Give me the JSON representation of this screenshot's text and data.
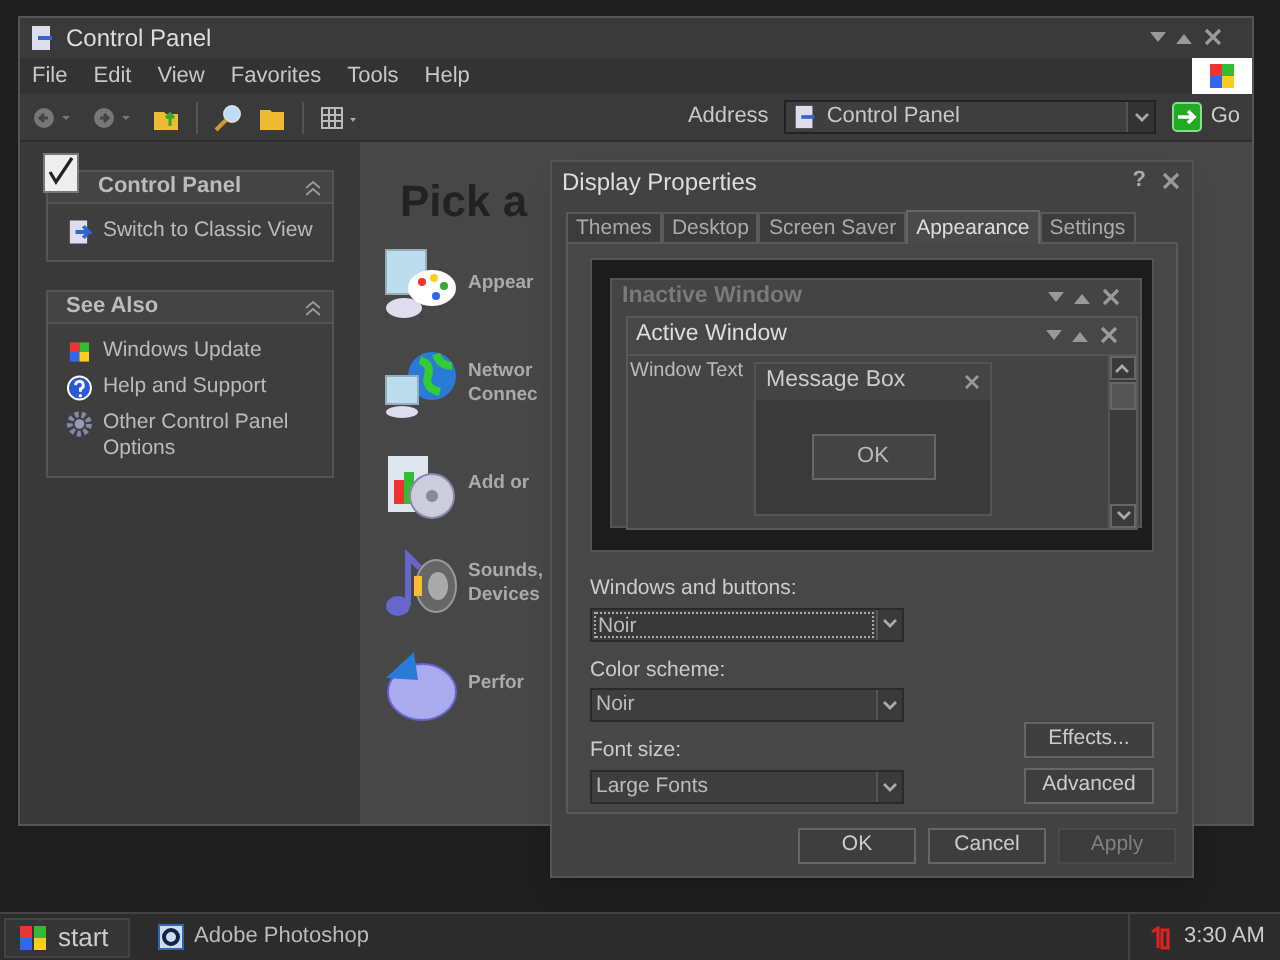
{
  "control_panel": {
    "title": "Control Panel",
    "menu": [
      "File",
      "Edit",
      "View",
      "Favorites",
      "Tools",
      "Help"
    ],
    "address": {
      "label": "Address",
      "value": "Control Panel",
      "go": "Go"
    },
    "task_panels": [
      {
        "title": "Control Panel",
        "items": [
          {
            "label": "Switch to Classic View",
            "kind": "classic"
          }
        ]
      },
      {
        "title": "See Also",
        "items": [
          {
            "label": "Windows Update",
            "kind": "update"
          },
          {
            "label": "Help and Support",
            "kind": "help"
          },
          {
            "label": "Other Control Panel Options",
            "kind": "gear"
          }
        ]
      }
    ],
    "heading": "Pick a",
    "categories": [
      {
        "lines": [
          "Appear"
        ],
        "kind": "appearance"
      },
      {
        "lines": [
          "Networ",
          "Connec"
        ],
        "kind": "network"
      },
      {
        "lines": [
          "Add or"
        ],
        "kind": "programs"
      },
      {
        "lines": [
          "Sounds,",
          "Devices"
        ],
        "kind": "sounds"
      },
      {
        "lines": [
          "Perfor"
        ],
        "kind": "performance"
      }
    ]
  },
  "display_properties": {
    "title": "Display Properties",
    "help": "?",
    "tabs": [
      {
        "label": "Themes",
        "selected": false
      },
      {
        "label": "Desktop",
        "selected": false
      },
      {
        "label": "Screen Saver",
        "selected": false
      },
      {
        "label": "Appearance",
        "selected": true
      },
      {
        "label": "Settings",
        "selected": false
      }
    ],
    "preview": {
      "inactive_title": "Inactive Window",
      "active_title": "Active Window",
      "window_text": "Window Text",
      "message_title": "Message Box",
      "message_button": "OK"
    },
    "fields": [
      {
        "label": "Windows and buttons:",
        "value": "Noir",
        "focused": true
      },
      {
        "label": "Color scheme:",
        "value": "Noir",
        "focused": false
      },
      {
        "label": "Font size:",
        "value": "Large Fonts",
        "focused": false
      }
    ],
    "side_buttons": [
      "Effects...",
      "Advanced"
    ],
    "buttons": [
      {
        "label": "OK",
        "disabled": false
      },
      {
        "label": "Cancel",
        "disabled": false
      },
      {
        "label": "Apply",
        "disabled": true
      }
    ]
  },
  "taskbar": {
    "start": "start",
    "tasks": [
      "Adobe Photoshop"
    ],
    "clock": "3:30 AM"
  }
}
